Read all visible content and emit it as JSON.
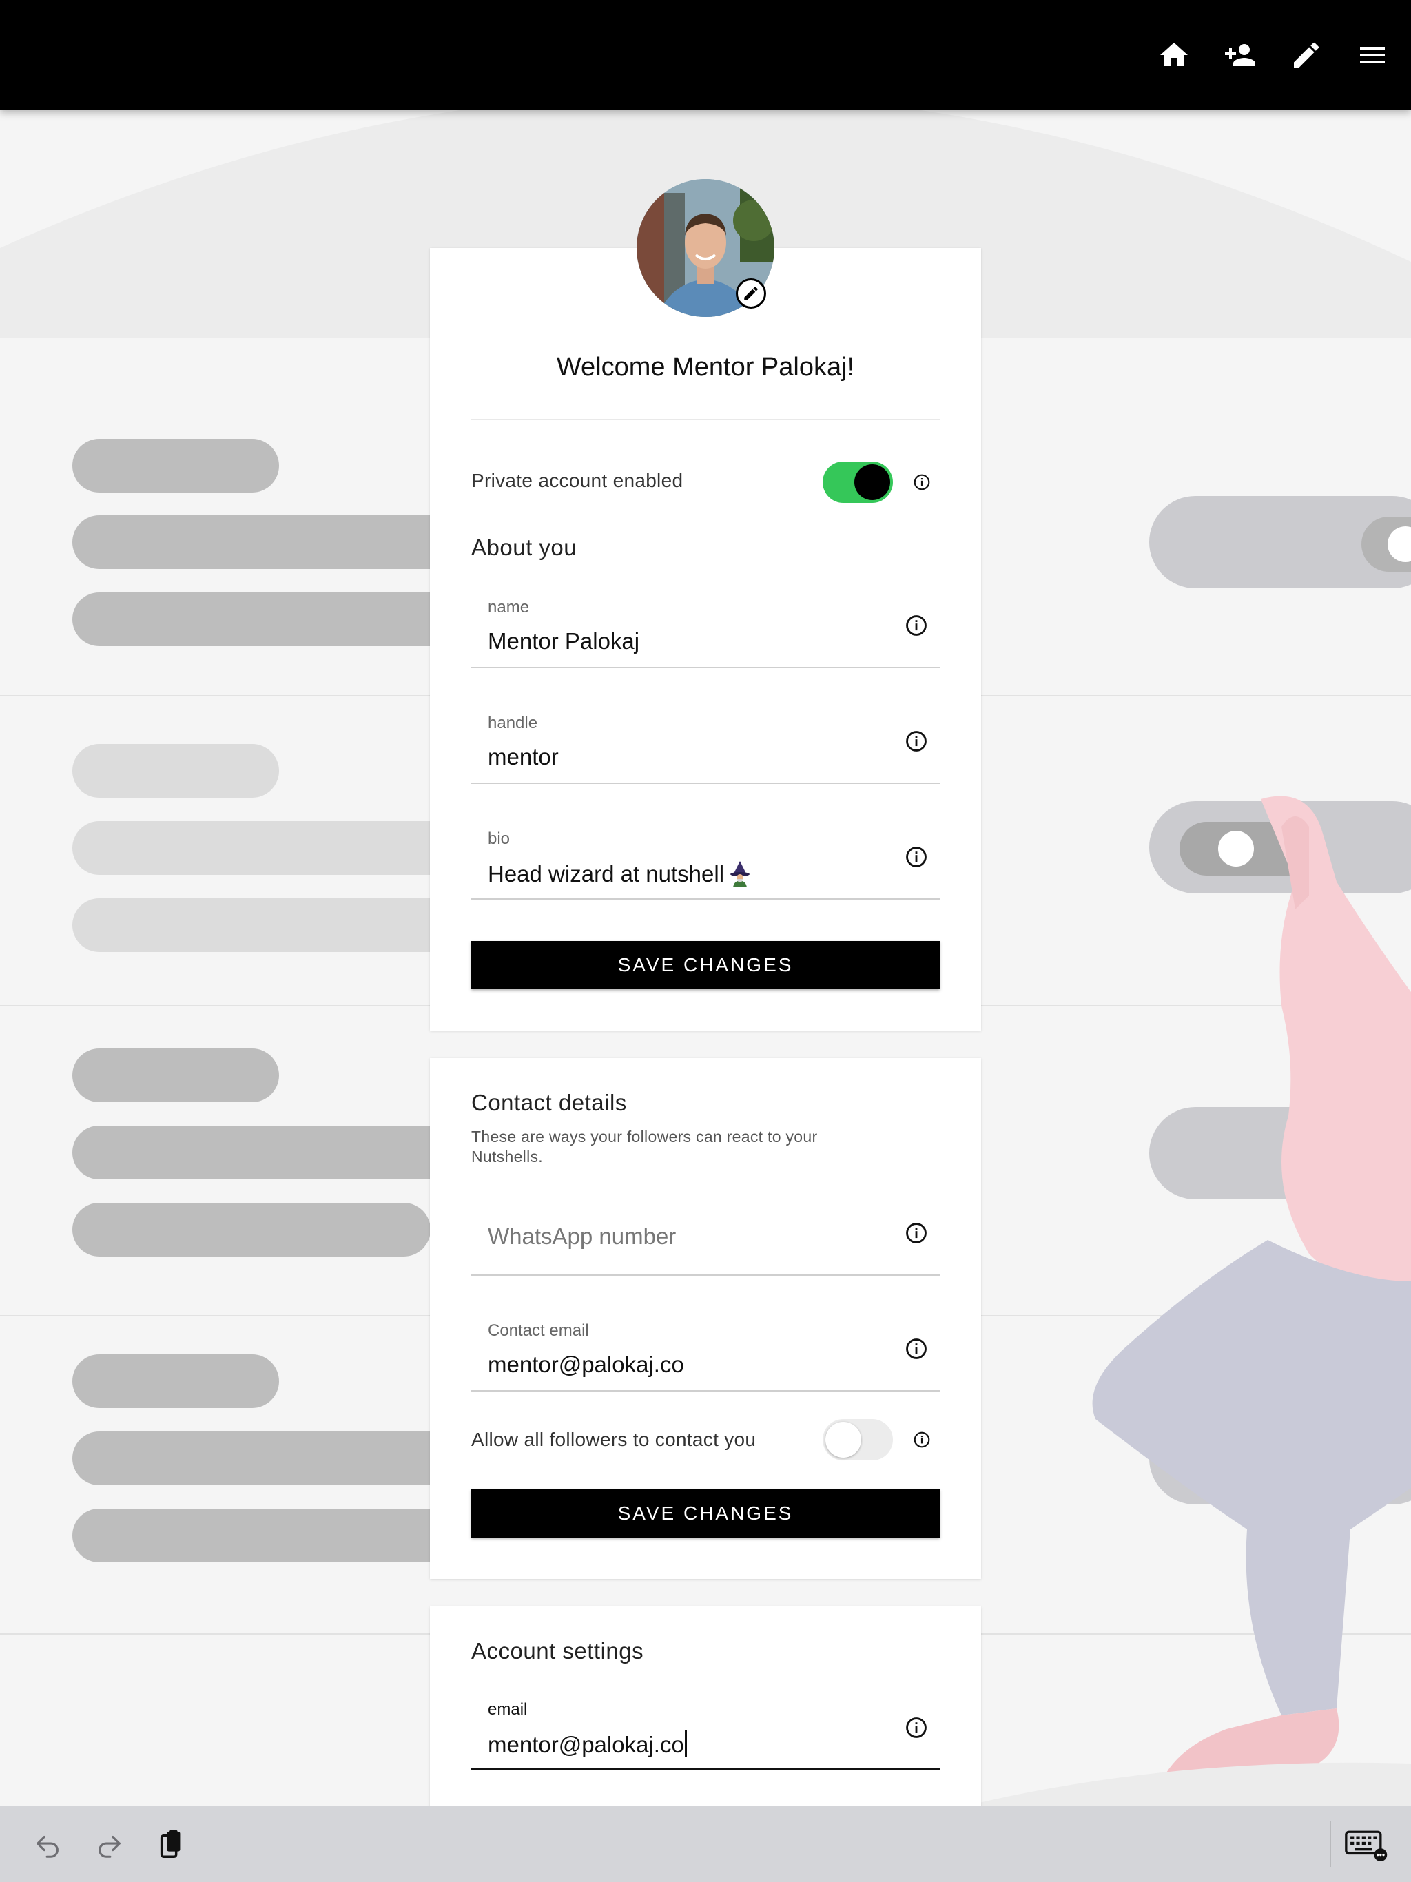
{
  "nav": {
    "icons": [
      "home-icon",
      "add-person-icon",
      "edit-pencil-icon",
      "menu-icon"
    ]
  },
  "profile": {
    "welcome": "Welcome Mentor Palokaj!",
    "private_label": "Private account enabled",
    "private_enabled": true,
    "about_title": "About you",
    "name_label": "name",
    "name_value": "Mentor Palokaj",
    "handle_label": "handle",
    "handle_value": "mentor",
    "bio_label": "bio",
    "bio_value": "Head wizard at nutshell",
    "save_label": "SAVE CHANGES"
  },
  "contact": {
    "title": "Contact details",
    "subtitle": "These are ways your followers can react to your Nutshells.",
    "whatsapp_placeholder": "WhatsApp number",
    "email_label": "Contact email",
    "email_value": "mentor@palokaj.co",
    "allow_label": "Allow all followers to contact you",
    "allow_enabled": false,
    "save_label": "SAVE CHANGES"
  },
  "account": {
    "title": "Account settings",
    "email_label": "email",
    "email_value": "mentor@palokaj.co"
  },
  "toolbar": {
    "icons": [
      "undo-icon",
      "redo-icon",
      "clipboard-icon",
      "keyboard-icon"
    ]
  },
  "colors": {
    "toggle_on": "#35c759",
    "topbar": "#000000",
    "button": "#000000"
  }
}
